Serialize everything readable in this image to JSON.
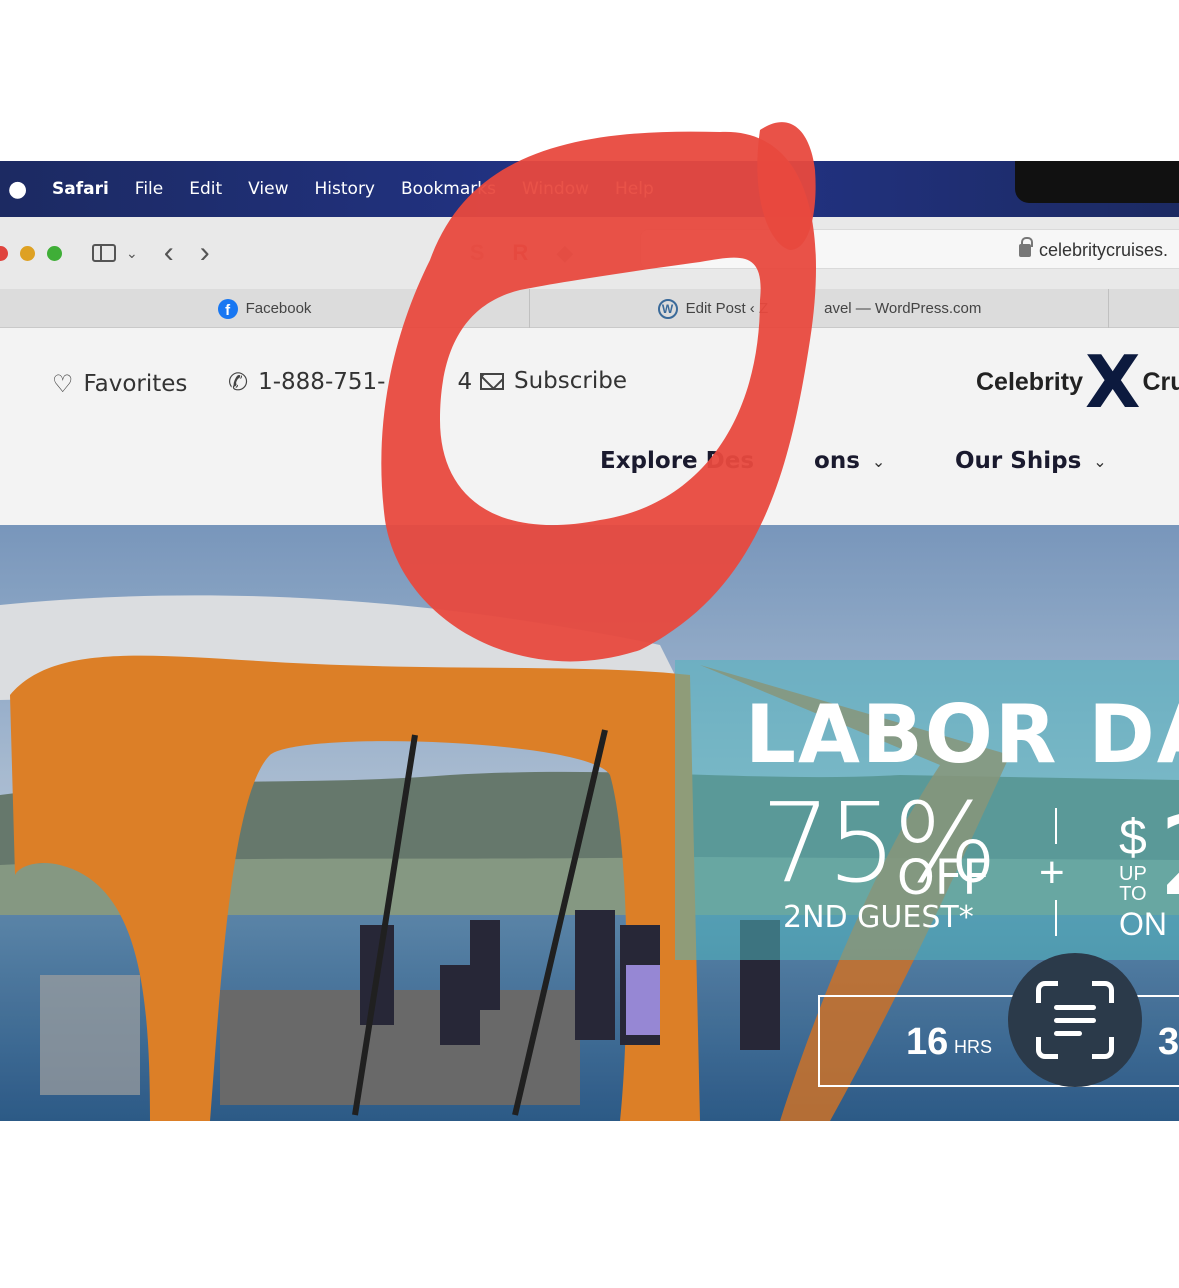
{
  "menubar": {
    "app": "Safari",
    "items": [
      "File",
      "Edit",
      "View",
      "History",
      "Bookmarks",
      "Window",
      "Help"
    ]
  },
  "toolbar": {
    "url": "celebritycruises."
  },
  "tabs": [
    {
      "label": "Facebook",
      "icon": "facebook-icon"
    },
    {
      "label": "Edit Post ‹ Z",
      "label_right": "avel — WordPress.com",
      "icon": "wordpress-icon"
    }
  ],
  "site": {
    "favorites": "Favorites",
    "phone": "1-888-751-",
    "phone_tail": "4",
    "subscribe": "Subscribe",
    "brand_left": "Celebrity",
    "brand_right": "Cru",
    "nav": [
      {
        "label": "Explore Des",
        "label_tail": "ons"
      },
      {
        "label": "Our Ships"
      }
    ]
  },
  "promo": {
    "title": "LABOR DA",
    "percent": "75%",
    "off": "OFF",
    "guest": "2ND GUEST*",
    "plus": "+",
    "dollar": "$",
    "up": "UP",
    "to": "TO",
    "amount": "2",
    "on": "ON"
  },
  "countdown": {
    "hours_value": "16",
    "hours_unit": "HRS",
    "next_value": "3"
  },
  "colors": {
    "menubar": "#23348a",
    "annotation": "#e8493e",
    "promo_panel": "#50b4be",
    "bus_orange": "#e8862a",
    "brand_navy": "#0c1a3e"
  }
}
